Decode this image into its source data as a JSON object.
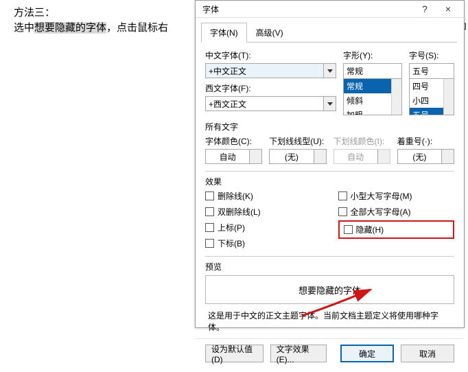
{
  "background": {
    "line1": "方法三：",
    "line2_pre": "选中",
    "line2_hl": "想要隐藏的字体",
    "line2_post": "，点击鼠标右",
    "right_tail": "能即"
  },
  "dialog": {
    "title": "字体",
    "help_icon": "?",
    "close_icon": "×",
    "tabs": {
      "font": "字体(N)",
      "advanced": "高级(V)"
    },
    "fields": {
      "chinese_font_label": "中文字体(T):",
      "chinese_font_value": "+中文正文",
      "western_font_label": "西文字体(F):",
      "western_font_value": "+西文正文",
      "style_label": "字形(Y):",
      "style_value": "常规",
      "style_options": [
        "常规",
        "倾斜",
        "加粗"
      ],
      "size_label": "字号(S):",
      "size_value": "五号",
      "size_options": [
        "四号",
        "小四",
        "五号"
      ]
    },
    "allchars_label": "所有文字",
    "font_color_label": "字体颜色(C):",
    "font_color_value": "自动",
    "underline_style_label": "下划线线型(U):",
    "underline_style_value": "(无)",
    "underline_color_label": "下划线颜色(I):",
    "underline_color_value": "自动",
    "emphasis_label": "着重号(·):",
    "emphasis_value": "(无)",
    "effects_label": "效果",
    "effects": {
      "strikethrough": "删除线(K)",
      "double_strike": "双删除线(L)",
      "superscript": "上标(P)",
      "subscript": "下标(B)",
      "small_caps": "小型大写字母(M)",
      "all_caps": "全部大写字母(A)",
      "hidden": "隐藏(H)"
    },
    "preview_label": "预览",
    "preview_text": "想要隐藏的字体",
    "preview_note": "这是用于中文的正文主题字体。当前文档主题定义将使用哪种字体。",
    "buttons": {
      "set_default": "设为默认值(D)",
      "text_effects": "文字效果(E)...",
      "ok": "确定",
      "cancel": "取消"
    }
  }
}
